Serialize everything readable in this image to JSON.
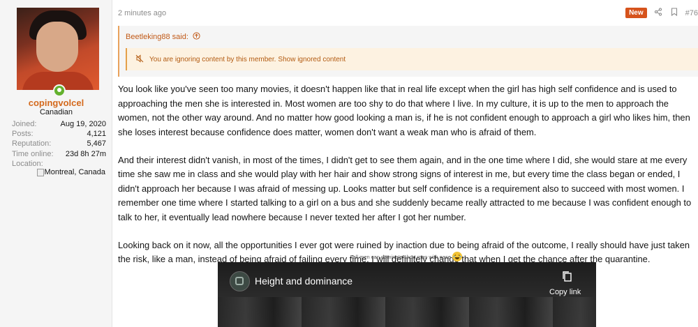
{
  "post": {
    "time": "2 minutes ago",
    "badge": "New",
    "number": "#76"
  },
  "user": {
    "name": "copingvolcel",
    "title": "Canadian",
    "stats": [
      {
        "key": "Joined:",
        "value": "Aug 19, 2020"
      },
      {
        "key": "Posts:",
        "value": "4,121"
      },
      {
        "key": "Reputation:",
        "value": "5,467"
      },
      {
        "key": "Time online:",
        "value": "23d 8h 27m"
      },
      {
        "key": "Location:",
        "value": ""
      }
    ],
    "location": "Montreal, Canada"
  },
  "quote": {
    "author": "Beetleking88 said:",
    "ignored_text": "You are ignoring content by this member.",
    "show_link": "Show ignored content"
  },
  "body": {
    "paragraphs": [
      "You look like you've seen too many movies, it doesn't happen like that in real life except when the girl has high self confidence and is used to approaching the men she is interested in. Most women are too shy to do that where I live. In my culture, it is up to the men to approach the women, not the other way around. And no matter how good looking a man is, if he is not confident enough to approach a girl who likes him, then she loses interest because confidence does matter, women don't want a weak man who is afraid of them.",
      "And their interest didn't vanish, in most of the times, I didn't get to see them again, and in the one time where I did, she would stare at me every time she saw me in class and she would play with her hair and show strong signs of interest in me, but every time the class began or ended, I didn't approach her because I was afraid of messing up. Looks matter but self confidence is a requirement also to succeed with most women. I remember one time where I started talking to a girl on a bus and she suddenly became really attracted to me because I was confident enough to talk to her, it eventually lead nowhere because I never texted her after I got her number.",
      "Looking back on it now, all the opportunities I ever got were ruined by inaction due to being afraid of the outcome, I really should have just taken the risk, like a man, instead of being afraid of failing every time. I will definitely change that when I get the chance after the quarantine."
    ],
    "caption": "Tall men can dominate short men with ease",
    "caption_suffix": ":"
  },
  "video": {
    "title": "Height and dominance",
    "copy_label": "Copy link"
  },
  "colors": {
    "username": "#d4691c",
    "badge": "#d6531c",
    "quote_bar": "#e9a25c",
    "ignored_bg": "#fdf2e1"
  }
}
